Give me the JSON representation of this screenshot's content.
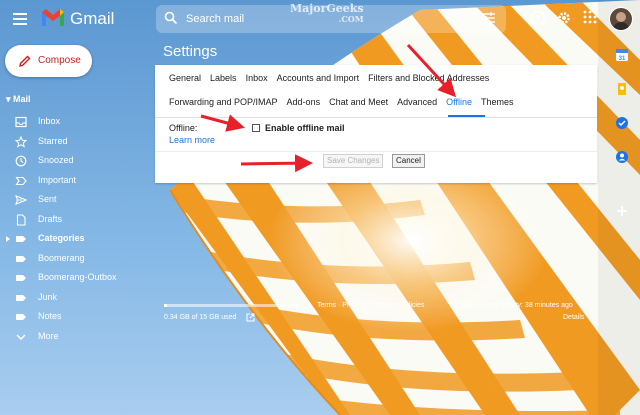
{
  "app": {
    "name": "Gmail",
    "watermark": "MajorGeeks",
    "watermark_sub": ".COM"
  },
  "search": {
    "placeholder": "Search mail"
  },
  "compose_label": "Compose",
  "sidebar": {
    "section": "Mail",
    "items": [
      {
        "label": "Inbox",
        "icon": "inbox-icon"
      },
      {
        "label": "Starred",
        "icon": "star-icon"
      },
      {
        "label": "Snoozed",
        "icon": "clock-icon"
      },
      {
        "label": "Important",
        "icon": "important-icon"
      },
      {
        "label": "Sent",
        "icon": "send-icon"
      },
      {
        "label": "Drafts",
        "icon": "draft-icon"
      },
      {
        "label": "Categories",
        "icon": "label-icon"
      },
      {
        "label": "Boomerang",
        "icon": "label-icon"
      },
      {
        "label": "Boomerang-Outbox",
        "icon": "label-icon"
      },
      {
        "label": "Junk",
        "icon": "label-icon"
      },
      {
        "label": "Notes",
        "icon": "label-icon"
      },
      {
        "label": "More",
        "icon": "chevron-down-icon"
      }
    ]
  },
  "settings": {
    "title": "Settings",
    "tabs_row1": [
      "General",
      "Labels",
      "Inbox",
      "Accounts and Import",
      "Filters and Blocked Addresses"
    ],
    "tabs_row2": [
      "Forwarding and POP/IMAP",
      "Add-ons",
      "Chat and Meet",
      "Advanced",
      "Offline",
      "Themes"
    ],
    "active_tab": "Offline",
    "offline_label": "Offline:",
    "enable_label": "Enable offline mail",
    "enable_checked": false,
    "learn_more": "Learn more",
    "save_label": "Save Changes",
    "cancel_label": "Cancel"
  },
  "footer": {
    "storage": "0.34 GB of 15 GB used",
    "storage_fraction": 0.023,
    "links": "Terms · Privacy · Program Policies",
    "activity": "Last account activity: 38 minutes ago",
    "details": "Details"
  },
  "colors": {
    "accent": "#1a73e8",
    "compose_text": "#c5221f",
    "arrow": "#e8202a",
    "umbrella_orange": "#f19a22",
    "sky": "#6fa7d9"
  }
}
